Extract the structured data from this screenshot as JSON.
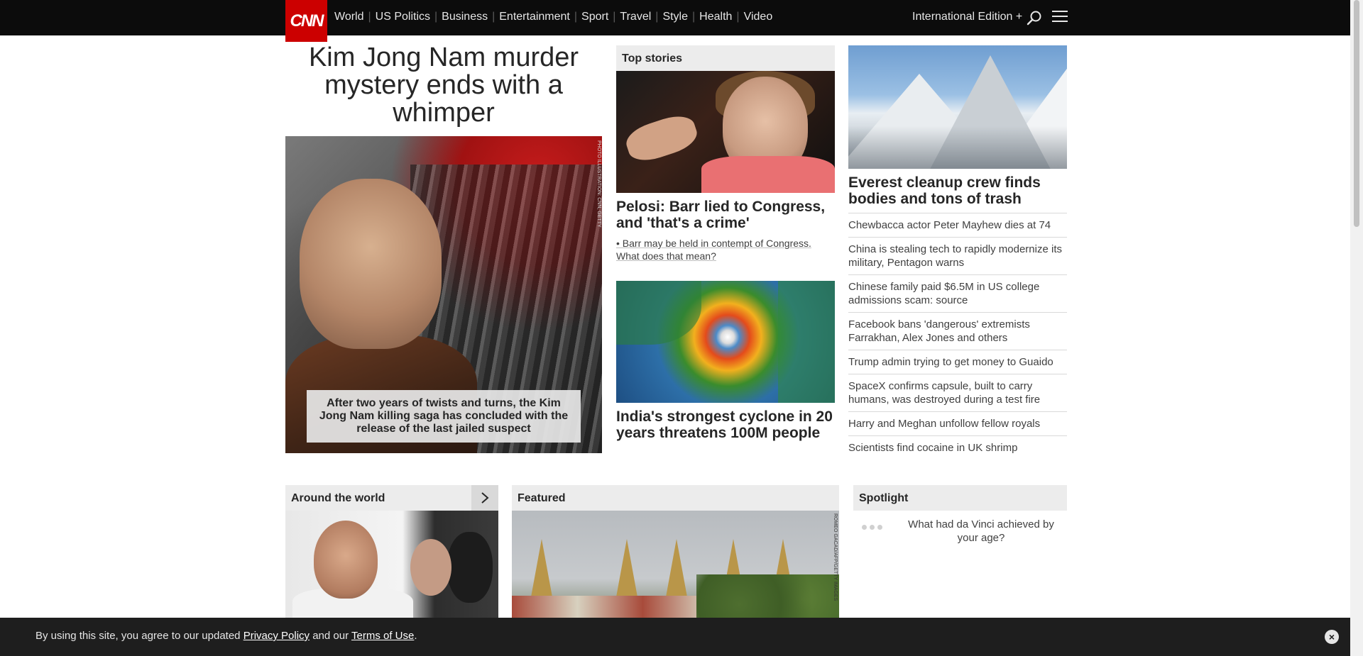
{
  "header": {
    "logo_text": "CNN",
    "nav": [
      "World",
      "US Politics",
      "Business",
      "Entertainment",
      "Sport",
      "Travel",
      "Style",
      "Health",
      "Video"
    ],
    "edition": "International Edition +",
    "colors": {
      "bar": "#0c0c0c",
      "logo": "#cc0000"
    }
  },
  "lead": {
    "headline": "Kim Jong Nam murder mystery ends with a whimper",
    "caption": "After two years of twists and turns, the Kim Jong Nam killing saga has concluded with the release of the last jailed suspect",
    "photo_credit": "PHOTO ILLUSTRATION: CNN, GETTY"
  },
  "top_stories": {
    "label": "Top stories",
    "story1": {
      "title": "Pelosi: Barr lied to Congress, and 'that's a crime'",
      "sub": "• Barr may be held in contempt of Congress. What does that mean?"
    },
    "story2": {
      "title": "India's strongest cyclone in 20 years threatens 100M people"
    }
  },
  "right": {
    "lead_title": "Everest cleanup crew finds bodies and tons of trash",
    "items": [
      "Chewbacca actor Peter Mayhew dies at 74",
      "China is stealing tech to rapidly modernize its military, Pentagon warns",
      "Chinese family paid $6.5M in US college admissions scam: source",
      "Facebook bans 'dangerous' extremists Farrakhan, Alex Jones and others",
      "Trump admin trying to get money to Guaido",
      "SpaceX confirms capsule, built to carry humans, was destroyed during a test fire",
      "Harry and Meghan unfollow fellow royals",
      "Scientists find cocaine in UK shrimp"
    ]
  },
  "lower": {
    "around": "Around the world",
    "featured": "Featured",
    "featured_credit": "ROMEO GACAD/AFP/GETTY IMAGES",
    "spotlight": "Spotlight",
    "spotlight_item": "What had da Vinci achieved by your age?"
  },
  "cookie": {
    "pre": "By using this site, you agree to our updated ",
    "privacy": "Privacy Policy",
    "mid": " and our ",
    "terms": "Terms of Use",
    "post": "."
  }
}
